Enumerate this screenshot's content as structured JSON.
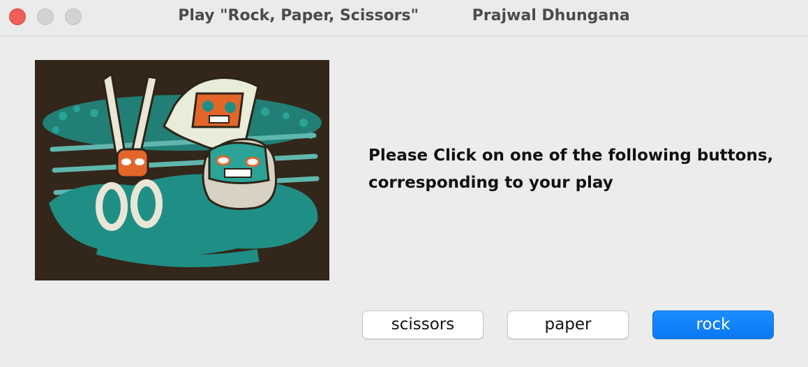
{
  "window": {
    "title": "Play \"Rock, Paper, Scissors\"          Prajwal Dhungana"
  },
  "instructions": {
    "line1": "Please Click on one of the following buttons,",
    "line2": "corresponding to your play"
  },
  "buttons": {
    "scissors": "scissors",
    "paper": "paper",
    "rock": "rock",
    "default": "rock"
  },
  "colors": {
    "accent": "#0a7bff",
    "art_background": "#33261a",
    "art_teal": "#1f8f86",
    "art_orange": "#e2662a"
  },
  "icons": {
    "close": "window-close-icon",
    "minimize": "window-minimize-icon",
    "maximize": "window-maximize-icon"
  }
}
